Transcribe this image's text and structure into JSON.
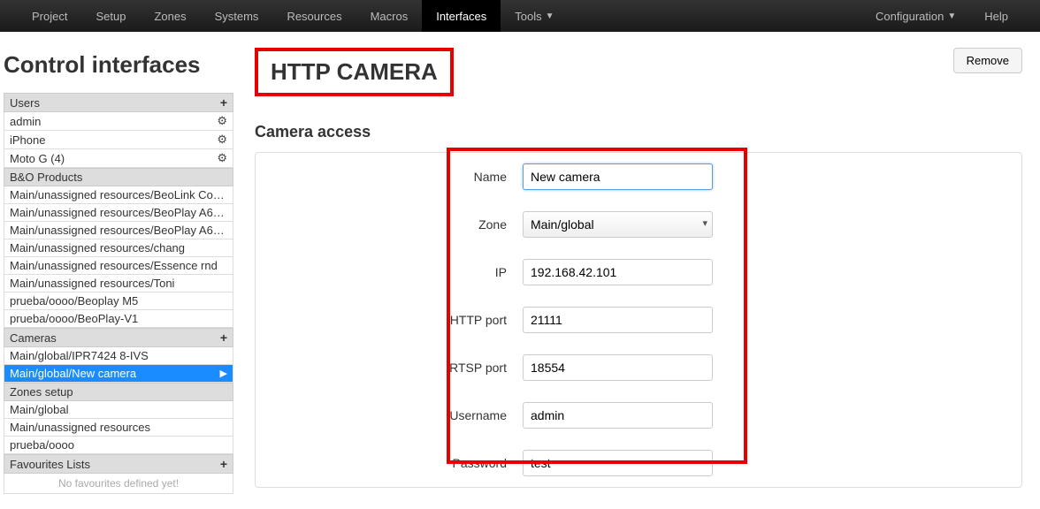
{
  "nav": {
    "left": [
      "Project",
      "Setup",
      "Zones",
      "Systems",
      "Resources",
      "Macros",
      "Interfaces",
      "Tools"
    ],
    "active": "Interfaces",
    "config": "Configuration",
    "help": "Help"
  },
  "sidebar": {
    "title": "Control interfaces",
    "groups": [
      {
        "name": "Users",
        "plus": true,
        "items": [
          {
            "label": "admin",
            "gear": true
          },
          {
            "label": "iPhone",
            "gear": true
          },
          {
            "label": "Moto G (4)",
            "gear": true
          }
        ]
      },
      {
        "name": "B&O Products",
        "plus": false,
        "items": [
          {
            "label": "Main/unassigned resources/BeoLink Co…"
          },
          {
            "label": "Main/unassigned resources/BeoPlay A6…"
          },
          {
            "label": "Main/unassigned resources/BeoPlay A6…"
          },
          {
            "label": "Main/unassigned resources/chang"
          },
          {
            "label": "Main/unassigned resources/Essence rnd"
          },
          {
            "label": "Main/unassigned resources/Toni"
          },
          {
            "label": "prueba/oooo/Beoplay M5"
          },
          {
            "label": "prueba/oooo/BeoPlay-V1"
          }
        ]
      },
      {
        "name": "Cameras",
        "plus": true,
        "items": [
          {
            "label": "Main/global/IPR7424 8-IVS"
          },
          {
            "label": "Main/global/New camera",
            "selected": true,
            "arrow": true
          }
        ]
      },
      {
        "name": "Zones setup",
        "plus": false,
        "items": [
          {
            "label": "Main/global"
          },
          {
            "label": "Main/unassigned resources"
          },
          {
            "label": "prueba/oooo"
          }
        ]
      },
      {
        "name": "Favourites Lists",
        "plus": true,
        "empty": "No favourites defined yet!"
      }
    ]
  },
  "content": {
    "title": "HTTP CAMERA",
    "remove": "Remove",
    "section": "Camera access",
    "form": {
      "name_label": "Name",
      "name_value": "New camera",
      "zone_label": "Zone",
      "zone_value": "Main/global",
      "ip_label": "IP",
      "ip_value": "192.168.42.101",
      "http_port_label": "HTTP port",
      "http_port_value": "21111",
      "rtsp_port_label": "RTSP port",
      "rtsp_port_value": "18554",
      "username_label": "Username",
      "username_value": "admin",
      "password_label": "Password",
      "password_value": "test"
    }
  }
}
